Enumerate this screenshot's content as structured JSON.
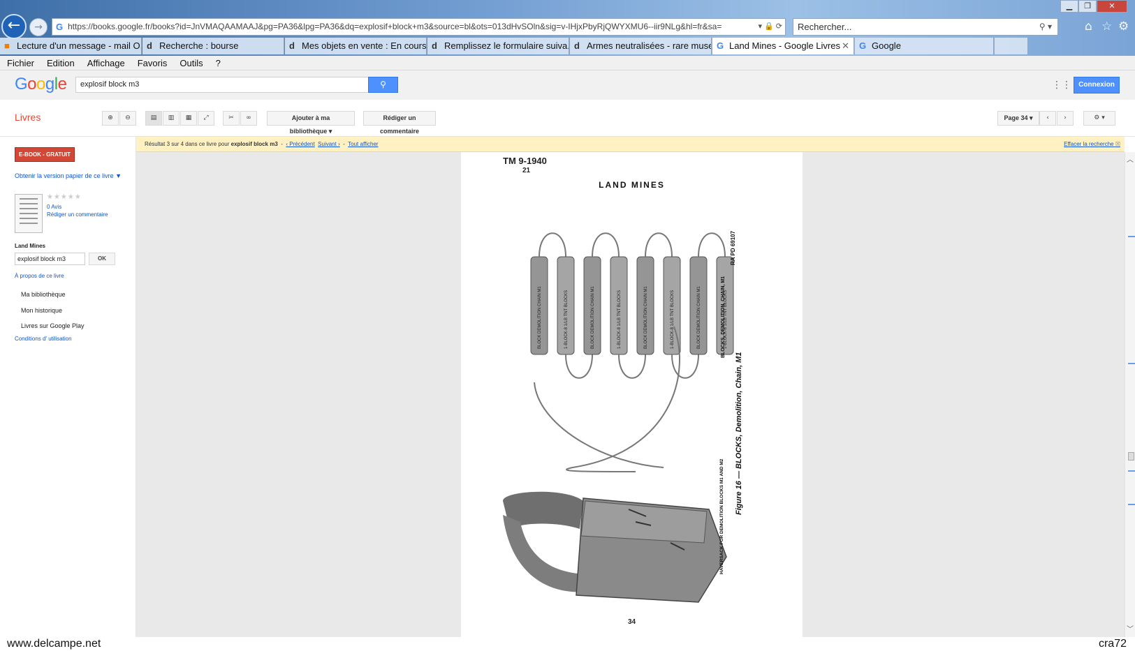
{
  "browser": {
    "url": "https://books.google.fr/books?id=JnVMAQAAMAAJ&pg=PA36&lpg=PA36&dq=explosif+block+m3&source=bl&ots=013dHvSOln&sig=v-IHjxPbyRjQWYXMU6--iir9NLg&hl=fr&sa=",
    "search_placeholder": "Rechercher...",
    "tabs": [
      {
        "label": "Lecture d'un message - mail O...",
        "icon": "orange"
      },
      {
        "label": "Recherche : bourse",
        "icon": "d"
      },
      {
        "label": "Mes objets en vente : En cours ...",
        "icon": "d"
      },
      {
        "label": "Remplissez le formulaire suiva...",
        "icon": "d"
      },
      {
        "label": "Armes neutralisées - rare muse...",
        "icon": "d"
      },
      {
        "label": "Land Mines - Google Livres",
        "icon": "G",
        "active": true
      },
      {
        "label": "Google",
        "icon": "G"
      }
    ],
    "menu": [
      "Fichier",
      "Edition",
      "Affichage",
      "Favoris",
      "Outils",
      "?"
    ]
  },
  "google": {
    "search_value": "explosif block m3",
    "connexion_label": "Connexion"
  },
  "books_toolbar": {
    "section_label": "Livres",
    "add_library_label": "Ajouter à ma bibliothèque",
    "write_review_label": "Rédiger un commentaire",
    "page_label": "Page 34"
  },
  "result_bar": {
    "prefix": "Résultat 3 sur 4 dans ce livre pour",
    "query": "explosif block m3",
    "prev_label": "‹ Précédent",
    "next_label": "Suivant ›",
    "show_all_label": "Tout afficher",
    "clear_label": "Effacer la recherche"
  },
  "sidebar": {
    "ebook_label": "E-BOOK - GRATUIT",
    "print_label": "Obtenir la version papier de ce livre ▼",
    "stars": "★★★★★",
    "reviews_label": "0 Avis",
    "write_review_label": "Rédiger un commentaire",
    "book_title": "Land Mines",
    "inbook_search_value": "explosif block m3",
    "ok_label": "OK",
    "about_label": "À propos de ce livre",
    "items": [
      "Ma bibliothèque",
      "Mon historique",
      "Livres sur Google Play"
    ],
    "conditions_label": "Conditions d' utilisation"
  },
  "page": {
    "header_left": "TM 9-1940",
    "header_sub": "21",
    "title": "LAND MINES",
    "figure_ref": "RA PD 69107",
    "caption_blocks": "BLOCKS, DEMOLITION, CHAIN, M1",
    "caption_haversack": "HAVERSACK FOR DEMOLITION BLOCKS M1 AND M2",
    "figure_caption": "Figure 16 — BLOCKS, Demolition, Chain, M1",
    "block_labels": [
      "BLOCK DEMOLITION CHAIN M1",
      "1-BLOCK-8 1/LB TNT BLOCKS",
      "BLOCK DEMOLITION CHAIN M1",
      "1-BLOCK-8 1/LB TNT BLOCKS",
      "BLOCK DEMOLITION CHAIN M1",
      "1-BLOCK-8 1/LB TNT BLOCKS",
      "BLOCK DEMOLITION CHAIN M1",
      "1-BLOCK-8 1/LB TNT BLOCKS"
    ],
    "number": "34"
  },
  "footer": {
    "left": "www.delcampe.net",
    "right": "cra72"
  },
  "colors": {
    "accent_blue": "#4d90fe",
    "livres_red": "#dd4b39",
    "ebook_red": "#d14836",
    "result_bar": "#fff1c1"
  }
}
